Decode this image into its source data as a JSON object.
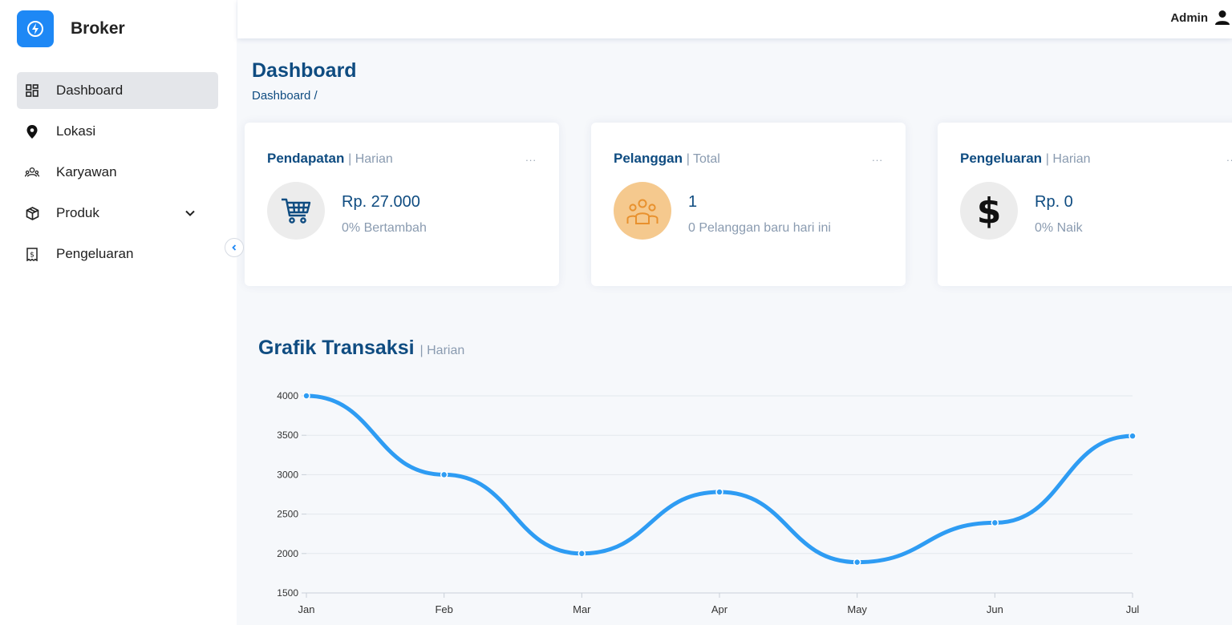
{
  "brand": {
    "name": "Broker",
    "logo_icon": "bolt-circle-icon",
    "logo_color": "#1e88f5"
  },
  "sidebar": {
    "items": [
      {
        "label": "Dashboard",
        "icon": "grid-icon",
        "active": true
      },
      {
        "label": "Lokasi",
        "icon": "map-pin-icon"
      },
      {
        "label": "Karyawan",
        "icon": "people-icon"
      },
      {
        "label": "Produk",
        "icon": "box-icon",
        "expandable": true
      },
      {
        "label": "Pengeluaran",
        "icon": "receipt-icon"
      }
    ]
  },
  "topbar": {
    "user_label": "Admin",
    "user_icon": "person-icon"
  },
  "page": {
    "title": "Dashboard",
    "breadcrumb": "Dashboard /"
  },
  "cards": [
    {
      "title": "Pendapatan",
      "subtitle": "| Harian",
      "value": "Rp. 27.000",
      "note": "0% Bertambah",
      "icon": "cart-icon",
      "icon_bg": "#ececec",
      "icon_color": "#0f4c81",
      "menu": "..."
    },
    {
      "title": "Pelanggan",
      "subtitle": "| Total",
      "value": "1",
      "note": "0 Pelanggan baru hari ini",
      "icon": "people-icon",
      "icon_bg": "#f5c98e",
      "icon_color": "#e8912e",
      "menu": "..."
    },
    {
      "title": "Pengeluaran",
      "subtitle": "| Harian",
      "value": "Rp. 0",
      "note": "0% Naik",
      "icon": "dollar-icon",
      "icon_bg": "#ececec",
      "icon_color": "#111111",
      "menu": "..."
    }
  ],
  "chart_section": {
    "title": "Grafik Transaksi",
    "subtitle": "| Harian"
  },
  "chart_data": {
    "type": "line",
    "title": "Grafik Transaksi",
    "categories": [
      "Jan",
      "Feb",
      "Mar",
      "Apr",
      "May",
      "Jun",
      "Jul"
    ],
    "series": [
      {
        "values": [
          4000,
          3000,
          2000,
          2780,
          1890,
          2390,
          3490
        ],
        "color": "#2e9cf3"
      }
    ],
    "ylim": [
      1500,
      4000
    ],
    "yticks": [
      1500,
      2000,
      2500,
      3000,
      3500,
      4000
    ],
    "grid": true,
    "smooth": true
  }
}
